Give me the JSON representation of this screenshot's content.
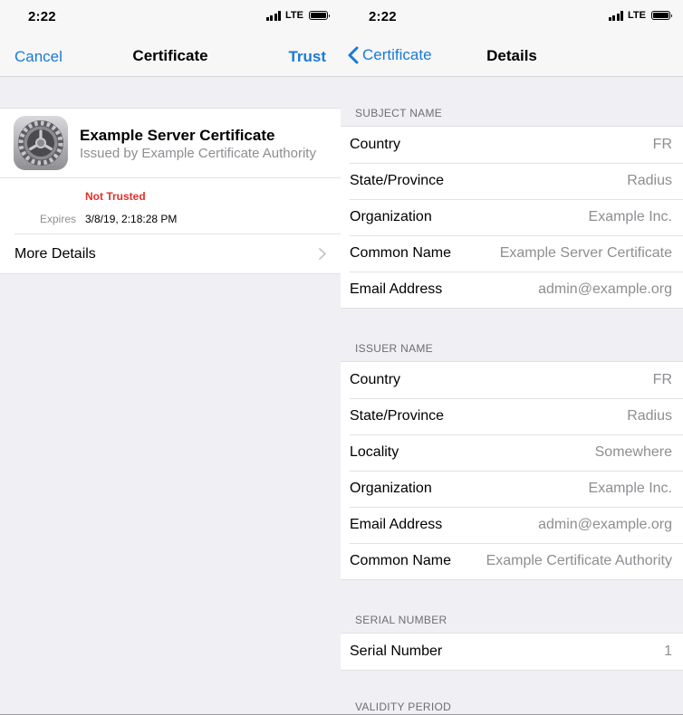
{
  "status": {
    "time": "2:22",
    "network": "LTE"
  },
  "left": {
    "nav": {
      "cancel": "Cancel",
      "title": "Certificate",
      "trust": "Trust"
    },
    "certificate": {
      "title": "Example Server Certificate",
      "issued_by": "Issued by Example Certificate Authority",
      "trust_status": "Not Trusted",
      "expires_label": "Expires",
      "expires_value": "3/8/19, 2:18:28 PM",
      "more_details": "More Details"
    },
    "colors": {
      "accent": "#1a7ad9",
      "warning": "#e0312b"
    }
  },
  "right": {
    "nav": {
      "back": "Certificate",
      "title": "Details"
    },
    "subject": {
      "header": "SUBJECT NAME",
      "rows": [
        {
          "label": "Country",
          "value": "FR"
        },
        {
          "label": "State/Province",
          "value": "Radius"
        },
        {
          "label": "Organization",
          "value": "Example Inc."
        },
        {
          "label": "Common Name",
          "value": "Example Server Certificate"
        },
        {
          "label": "Email Address",
          "value": "admin@example.org"
        }
      ]
    },
    "issuer": {
      "header": "ISSUER NAME",
      "rows": [
        {
          "label": "Country",
          "value": "FR"
        },
        {
          "label": "State/Province",
          "value": "Radius"
        },
        {
          "label": "Locality",
          "value": "Somewhere"
        },
        {
          "label": "Organization",
          "value": "Example Inc."
        },
        {
          "label": "Email Address",
          "value": "admin@example.org"
        },
        {
          "label": "Common Name",
          "value": "Example Certificate Authority"
        }
      ]
    },
    "serial": {
      "header": "SERIAL NUMBER",
      "rows": [
        {
          "label": "Serial Number",
          "value": "1"
        }
      ]
    },
    "validity": {
      "header": "VALIDITY PERIOD"
    }
  }
}
